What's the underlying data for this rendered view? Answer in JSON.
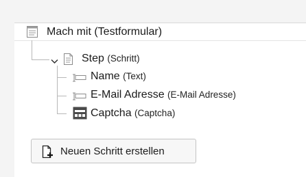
{
  "tree": {
    "root": {
      "label": "Mach mit (Testformular)",
      "icon": "form-document-icon"
    },
    "step": {
      "label": "Step",
      "type": "(Schritt)",
      "icon": "page-icon",
      "toggle_icon": "chevron-down-icon"
    },
    "fields": [
      {
        "label": "Name",
        "type": "(Text)",
        "icon": "text-field-icon"
      },
      {
        "label": "E-Mail Adresse",
        "type": "(E-Mail Adresse)",
        "icon": "text-field-icon"
      },
      {
        "label": "Captcha",
        "type": "(Captcha)",
        "icon": "captcha-icon"
      }
    ]
  },
  "actions": {
    "new_step_label": "Neuen Schritt erstellen",
    "new_step_icon": "new-page-plus-icon"
  },
  "colors": {
    "panel_bg": "#ffffff",
    "page_bg": "#f4f4f4",
    "tree_line": "#b7b7b7",
    "captcha_icon": "#4a4a4a"
  }
}
